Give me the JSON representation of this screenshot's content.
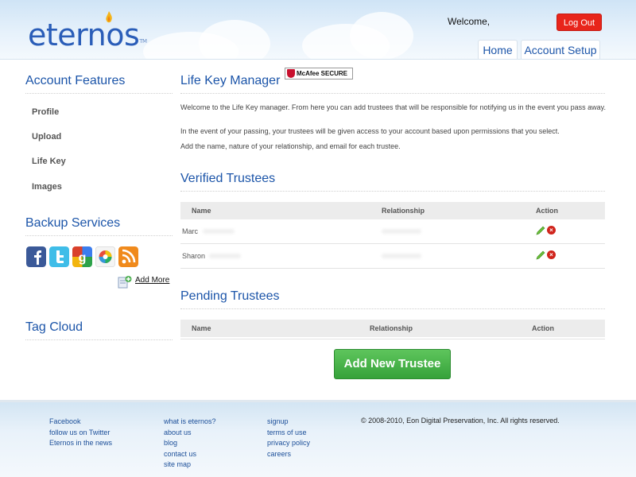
{
  "header": {
    "logo_text": "eternos",
    "logo_tm": "TM",
    "welcome": "Welcome,",
    "logout_label": "Log Out",
    "nav": {
      "home": "Home",
      "account_setup": "Account Setup"
    }
  },
  "sidebar": {
    "features_heading": "Account Features",
    "features": [
      "Profile",
      "Upload",
      "Life Key",
      "Images"
    ],
    "backup_heading": "Backup Services",
    "backup_icons": [
      "facebook-icon",
      "twitter-icon",
      "google-icon",
      "picasa-icon",
      "rss-icon"
    ],
    "add_more": "Add More",
    "tag_cloud_heading": "Tag Cloud"
  },
  "main": {
    "title": "Life Key Manager",
    "paragraphs": [
      "Welcome to the Life Key manager. From here you can add trustees that will be responsible for notifying us in the event you pass away.",
      "In the event of your passing, your trustees will be given access to your account based upon permissions that you select.",
      "Add the name, nature of your relationship, and email for each trustee."
    ],
    "verified": {
      "heading": "Verified Trustees",
      "columns": [
        "Name",
        "Relationship",
        "Action"
      ],
      "rows": [
        {
          "name": "Marc"
        },
        {
          "name": "Sharon"
        }
      ]
    },
    "pending": {
      "heading": "Pending Trustees",
      "columns": [
        "Name",
        "Relationship",
        "Action"
      ]
    },
    "add_button": "Add New Trustee"
  },
  "footer": {
    "col1": [
      "Facebook",
      "follow us on Twitter",
      "Eternos in the news"
    ],
    "col2": [
      "what is eternos?",
      "about us",
      "blog",
      "contact us",
      "site map"
    ],
    "col3": [
      "signup",
      "terms of use",
      "privacy policy",
      "careers"
    ],
    "copyright": "© 2008-2010, Eon Digital Preservation, Inc. All rights reserved.",
    "badge": "McAfee SECURE"
  },
  "colors": {
    "brand_blue": "#1c55a9",
    "logout_red": "#e8251b",
    "add_green": "#3fae42"
  }
}
